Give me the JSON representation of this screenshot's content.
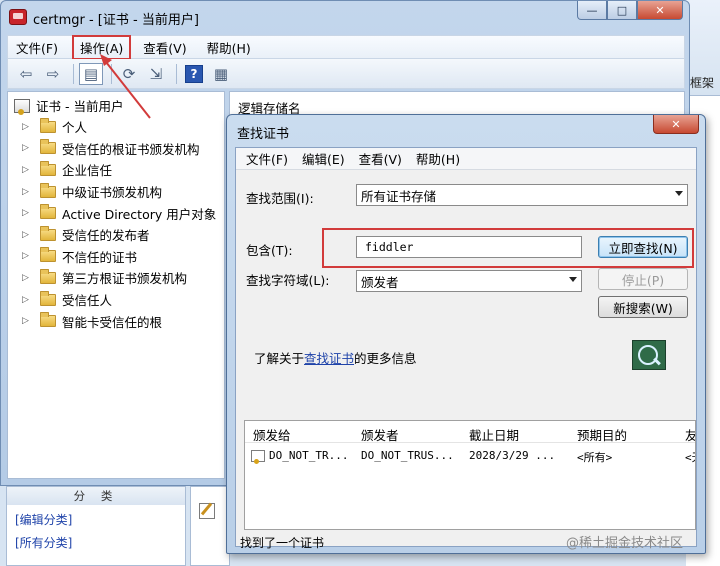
{
  "window": {
    "title": "certmgr - [证书 - 当前用户]",
    "minimize_glyph": "—",
    "maximize_glyph": "□",
    "close_glyph": "✕"
  },
  "menubar": {
    "items": [
      "文件(F)",
      "操作(A)",
      "查看(V)",
      "帮助(H)"
    ],
    "highlighted_index": 1
  },
  "toolbar": {
    "icons": [
      "back-arrow-icon",
      "forward-arrow-icon",
      "show-hide-tree-icon",
      "refresh-icon",
      "export-list-icon",
      "help-icon",
      "properties-icon"
    ],
    "help_glyph": "?"
  },
  "tree": {
    "root_label": "证书 - 当前用户",
    "items": [
      "个人",
      "受信任的根证书颁发机构",
      "企业信任",
      "中级证书颁发机构",
      "Active Directory 用户对象",
      "受信任的发布者",
      "不信任的证书",
      "第三方根证书颁发机构",
      "受信任人",
      "智能卡受信任的根"
    ],
    "expander_glyph": "▷"
  },
  "right_pane": {
    "column_header": "逻辑存储名",
    "bg_strip_text": "框架"
  },
  "bottom": {
    "category_header": "分 类",
    "links": [
      "[编辑分类]",
      "[所有分类]"
    ]
  },
  "dialog": {
    "title": "查找证书",
    "close_glyph": "✕",
    "menu": [
      "文件(F)",
      "编辑(E)",
      "查看(V)",
      "帮助(H)"
    ],
    "scope_label": "查找范围(I):",
    "scope_value": "所有证书存储",
    "contains_label": "包含(T):",
    "contains_value": "fiddler",
    "field_label": "查找字符域(L):",
    "field_value": "颁发者",
    "find_now_button": "立即查找(N)",
    "stop_button": "停止(P)",
    "new_search_button": "新搜索(W)",
    "info_prefix": "了解关于",
    "info_link": "查找证书",
    "info_suffix": "的更多信息",
    "results": {
      "columns": [
        "颁发给",
        "颁发者",
        "截止日期",
        "预期目的",
        "友好"
      ],
      "rows": [
        [
          "DO_NOT_TR...",
          "DO_NOT_TRUS...",
          "2028/3/29 ...",
          "<所有>",
          "<无>"
        ]
      ]
    },
    "status": "找到了一个证书"
  },
  "watermark": "@稀土掘金技术社区",
  "colors": {
    "highlight_red": "#d23b3b",
    "link_blue": "#1f43a9",
    "title_bar": "#c3d6ec"
  }
}
